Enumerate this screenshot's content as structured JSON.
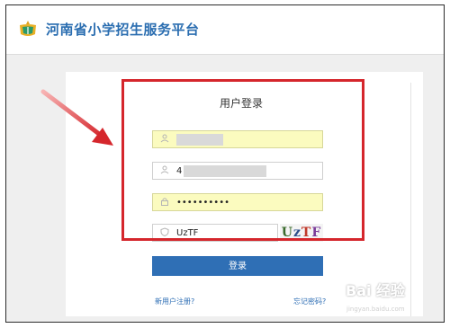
{
  "header": {
    "site_title": "河南省小学招生服务平台",
    "logo_icon": "education-logo-icon"
  },
  "login_form": {
    "title": "用户登录",
    "username_field": {
      "icon": "user-icon",
      "value": ""
    },
    "id_field": {
      "icon": "user-icon",
      "value": "4"
    },
    "password_field": {
      "icon": "lock-icon",
      "value": "••••••••••"
    },
    "captcha_field": {
      "icon": "shield-icon",
      "value": "UzTF"
    },
    "captcha_image_text": [
      "U",
      "z",
      "T",
      "F"
    ],
    "login_button": "登录",
    "register_link": "新用户注册?",
    "forgot_link": "忘记密码?"
  },
  "annotation": {
    "highlight_color": "#d5262c"
  },
  "watermark": {
    "text": "Bai 经验",
    "sub": "jingyan.baidu.com"
  }
}
